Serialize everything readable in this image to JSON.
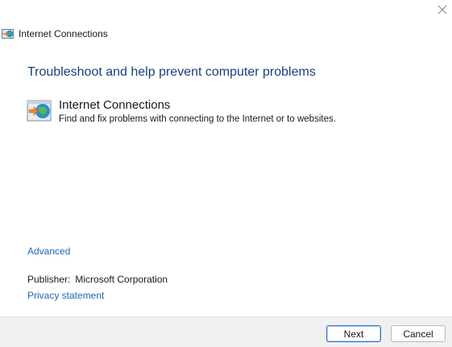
{
  "window": {
    "title": "Internet Connections"
  },
  "main": {
    "heading": "Troubleshoot and help prevent computer problems",
    "item": {
      "title": "Internet Connections",
      "description": "Find and fix problems with connecting to the Internet or to websites.",
      "icon": "network-globe-icon"
    },
    "advanced_link": "Advanced",
    "publisher_label": "Publisher:",
    "publisher_value": "Microsoft Corporation",
    "privacy_link": "Privacy statement"
  },
  "footer": {
    "next_label": "Next",
    "cancel_label": "Cancel"
  },
  "colors": {
    "heading": "#1b3f7a",
    "link": "#1e66b0",
    "footer_bg": "#f0f0f0",
    "default_button_border": "#2a6fc4"
  }
}
